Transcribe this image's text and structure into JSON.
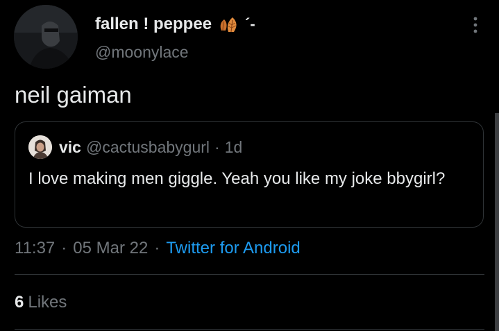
{
  "tweet": {
    "author": {
      "display_name": "fallen ! peppee",
      "name_emoji": "leaf-emoji",
      "name_suffix": "´-",
      "handle": "@moonylace"
    },
    "text": "neil gaiman",
    "quoted_tweet": {
      "author_name": "vic",
      "author_handle": "@cactusbabygurl",
      "separator": "·",
      "time_ago": "1d",
      "text": "I love making men giggle. Yeah you like my joke bbygirl?"
    },
    "meta": {
      "time": "11:37",
      "separator": "·",
      "date": "05 Mar 22",
      "source": "Twitter for Android"
    },
    "likes": {
      "count": "6",
      "label": "Likes"
    }
  },
  "icons": {
    "more": "more-vertical-icon",
    "avatar": "user-avatar",
    "quoted_avatar": "quoted-user-avatar"
  },
  "colors": {
    "background": "#000000",
    "primary_text": "#e7e9ea",
    "secondary_text": "#71767b",
    "link": "#1d9bf0",
    "border": "#2f3336"
  }
}
